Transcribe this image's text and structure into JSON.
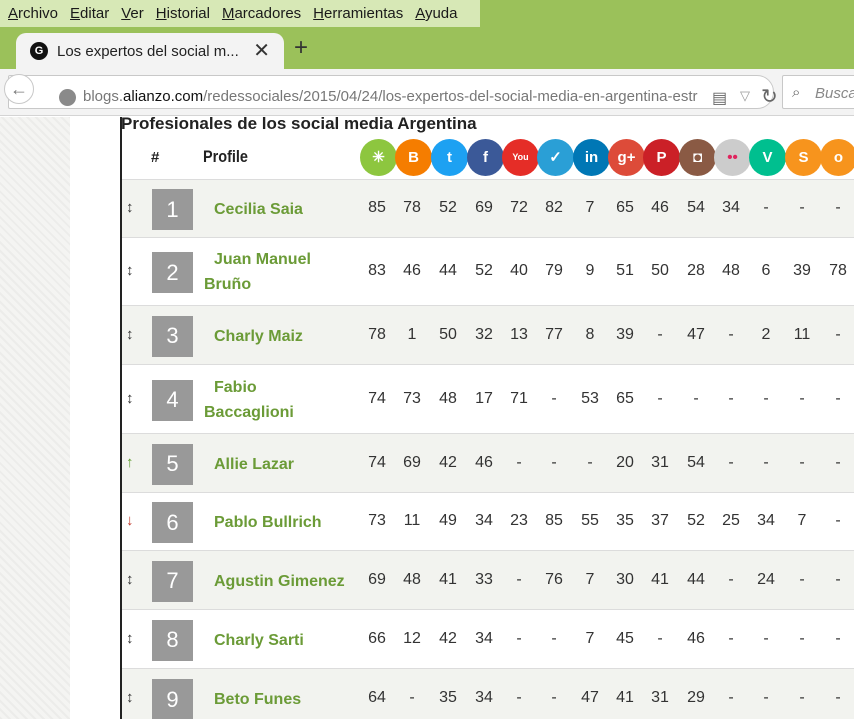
{
  "menu": [
    "Archivo",
    "Editar",
    "Ver",
    "Historial",
    "Marcadores",
    "Herramientas",
    "Ayuda"
  ],
  "tab": {
    "favicon_letter": "G",
    "title": "Los expertos del social m...",
    "close": "✕",
    "new_tab": "+"
  },
  "nav": {
    "url_prefix": "blogs.",
    "url_domain": "alianzo.com",
    "url_path": "/redessociales/2015/04/24/los-expertos-del-social-media-en-argentina-estr",
    "search_placeholder": "Buscar"
  },
  "page": {
    "heading": "Profesionales de los social media Argentina",
    "col_rank": "#",
    "col_profile": "Profile",
    "networks": [
      {
        "name": "klout",
        "color": "#8dc63f",
        "glyph": "✳"
      },
      {
        "name": "blogger",
        "color": "#f57d00",
        "glyph": "B"
      },
      {
        "name": "twitter",
        "color": "#1da1f2",
        "glyph": "t"
      },
      {
        "name": "facebook",
        "color": "#3b5998",
        "glyph": "f"
      },
      {
        "name": "youtube",
        "color": "#e52d27",
        "glyph": "You"
      },
      {
        "name": "delicious",
        "color": "#2a9fd6",
        "glyph": "✓"
      },
      {
        "name": "linkedin",
        "color": "#0077b5",
        "glyph": "in"
      },
      {
        "name": "googleplus",
        "color": "#dd4b39",
        "glyph": "g+"
      },
      {
        "name": "pinterest",
        "color": "#cb2027",
        "glyph": "P"
      },
      {
        "name": "instagram",
        "color": "#8a5a44",
        "glyph": "◘"
      },
      {
        "name": "flickr",
        "color": "#cccccc",
        "glyph": "••"
      },
      {
        "name": "vine",
        "color": "#00bf8f",
        "glyph": "V"
      },
      {
        "name": "slideshare",
        "color": "#f7941d",
        "glyph": "S"
      },
      {
        "name": "other",
        "color": "#f7941d",
        "glyph": "o"
      }
    ],
    "rows": [
      {
        "rank": "1",
        "trend": "same",
        "arrow": "↕",
        "name": "Cecilia Saia",
        "values": [
          "85",
          "78",
          "52",
          "69",
          "72",
          "82",
          "7",
          "65",
          "46",
          "54",
          "34",
          "-",
          "-",
          "-"
        ]
      },
      {
        "rank": "2",
        "trend": "same",
        "arrow": "↕",
        "name": "Juan Manuel Bruño",
        "values": [
          "83",
          "46",
          "44",
          "52",
          "40",
          "79",
          "9",
          "51",
          "50",
          "28",
          "48",
          "6",
          "39",
          "78"
        ]
      },
      {
        "rank": "3",
        "trend": "same",
        "arrow": "↕",
        "name": "Charly Maiz",
        "values": [
          "78",
          "1",
          "50",
          "32",
          "13",
          "77",
          "8",
          "39",
          "-",
          "47",
          "-",
          "2",
          "11",
          "-"
        ]
      },
      {
        "rank": "4",
        "trend": "same",
        "arrow": "↕",
        "name": "Fabio Baccaglioni",
        "values": [
          "74",
          "73",
          "48",
          "17",
          "71",
          "-",
          "53",
          "65",
          "-",
          "-",
          "-",
          "-",
          "-",
          "-"
        ]
      },
      {
        "rank": "5",
        "trend": "up",
        "arrow": "↑",
        "name": "Allie Lazar",
        "values": [
          "74",
          "69",
          "42",
          "46",
          "-",
          "-",
          "-",
          "20",
          "31",
          "54",
          "-",
          "-",
          "-",
          "-"
        ]
      },
      {
        "rank": "6",
        "trend": "down",
        "arrow": "↓",
        "name": "Pablo Bullrich",
        "values": [
          "73",
          "11",
          "49",
          "34",
          "23",
          "85",
          "55",
          "35",
          "37",
          "52",
          "25",
          "34",
          "7",
          "-"
        ]
      },
      {
        "rank": "7",
        "trend": "same",
        "arrow": "↕",
        "name": "Agustin Gimenez",
        "values": [
          "69",
          "48",
          "41",
          "33",
          "-",
          "76",
          "7",
          "30",
          "41",
          "44",
          "-",
          "24",
          "-",
          "-"
        ]
      },
      {
        "rank": "8",
        "trend": "same",
        "arrow": "↕",
        "name": "Charly Sarti",
        "values": [
          "66",
          "12",
          "42",
          "34",
          "-",
          "-",
          "7",
          "45",
          "-",
          "46",
          "-",
          "-",
          "-",
          "-"
        ]
      },
      {
        "rank": "9",
        "trend": "same",
        "arrow": "↕",
        "name": "Beto Funes",
        "values": [
          "64",
          "-",
          "35",
          "34",
          "-",
          "-",
          "47",
          "41",
          "31",
          "29",
          "-",
          "-",
          "-",
          "-"
        ]
      }
    ]
  },
  "colors": {
    "menubar": "#9bc15a",
    "name_green": "#6b9b37",
    "rank_box": "#999999",
    "arrow_up": "#5d9b2b",
    "arrow_down": "#c0392b"
  }
}
